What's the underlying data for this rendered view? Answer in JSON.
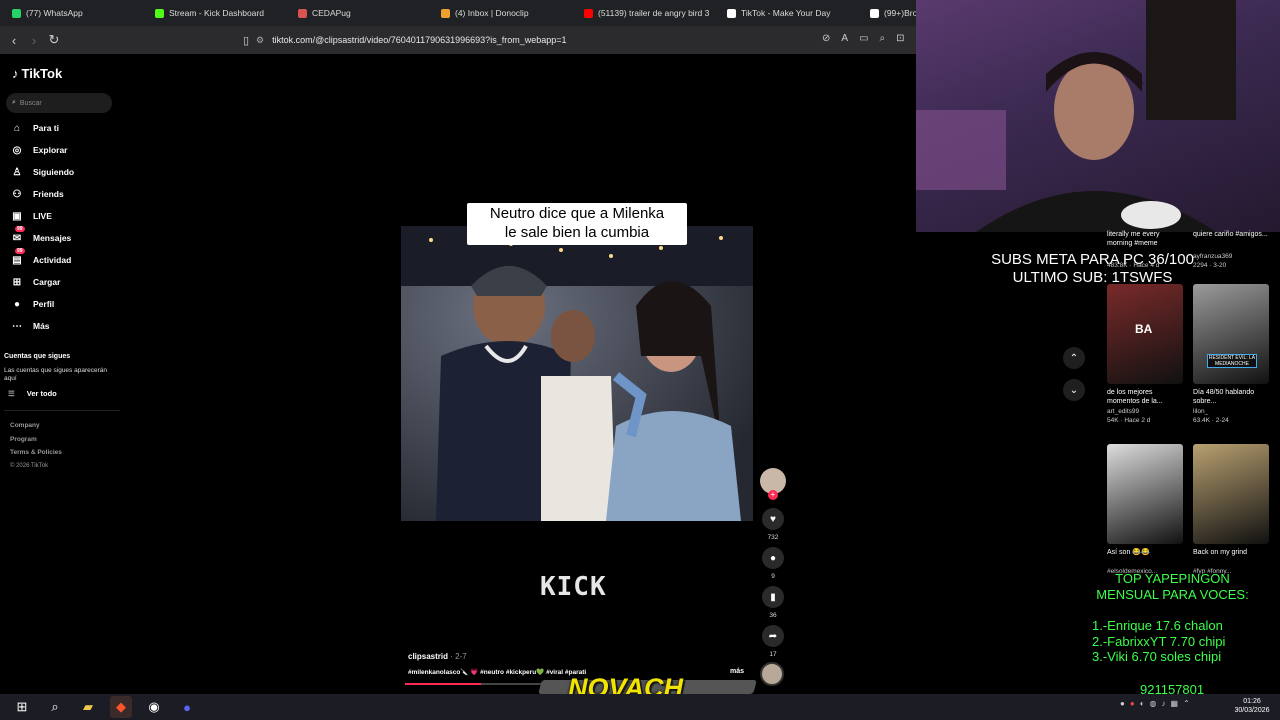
{
  "browser": {
    "tabs": [
      {
        "title": "(77) WhatsApp",
        "color": "#25d366"
      },
      {
        "title": "Stream - Kick Dashboard",
        "color": "#53fc18"
      },
      {
        "title": "CEDAPug",
        "color": "#d9534f"
      },
      {
        "title": "(4) Inbox | Donoclip",
        "color": "#f0a030"
      },
      {
        "title": "(51139) trailer de angry bird 3",
        "color": "#ff0000"
      },
      {
        "title": "TikTok - Make Your Day",
        "color": "#ffffff"
      },
      {
        "title": "(99+)Bro...",
        "color": "#ffffff"
      }
    ],
    "url": "tiktok.com/@clipsastrid/video/7604011790631996693?is_from_webapp=1"
  },
  "tiktok": {
    "logo": "TikTok",
    "search_placeholder": "Buscar",
    "nav": [
      {
        "label": "Para ti",
        "icon": "home-icon",
        "glyph": "⌂"
      },
      {
        "label": "Explorar",
        "icon": "compass-icon",
        "glyph": "◎"
      },
      {
        "label": "Siguiendo",
        "icon": "following-icon",
        "glyph": "♙"
      },
      {
        "label": "Friends",
        "icon": "friends-icon",
        "glyph": "⚇"
      },
      {
        "label": "LIVE",
        "icon": "live-icon",
        "glyph": "▣"
      },
      {
        "label": "Mensajes",
        "icon": "messages-icon",
        "glyph": "✉",
        "badge": "99"
      },
      {
        "label": "Actividad",
        "icon": "activity-icon",
        "glyph": "▤",
        "badge": "99"
      },
      {
        "label": "Cargar",
        "icon": "upload-icon",
        "glyph": "⊞"
      },
      {
        "label": "Perfil",
        "icon": "profile-icon",
        "glyph": "●"
      },
      {
        "label": "Más",
        "icon": "more-icon",
        "glyph": "⋯"
      }
    ],
    "following_title": "Cuentas que sigues",
    "following_desc": "Las cuentas que sigues aparecerán aquí",
    "see_all": "Ver todo",
    "footer": [
      "Company",
      "Program",
      "Terms & Policies",
      "© 2026 TikTok"
    ],
    "video": {
      "caption_line1": "Neutro dice que a Milenka",
      "caption_line2": "le sale bien la cumbia",
      "watermark": "KICK",
      "author": "clipsastrid",
      "date": "· 2-7",
      "hashtags": "#milenkanolasco🔪 💗 #neutro #kickperu💚 #viral #parati",
      "more": "más"
    },
    "actions": {
      "likes": "732",
      "comments": "9",
      "saves": "36",
      "shares": "17"
    }
  },
  "overlay": {
    "subs_line1": "SUBS META PARA PC 36/100",
    "subs_line2": "ULTIMO SUB: 1TSWFS",
    "top_title1": "TOP YAPEPINGON",
    "top_title2": "MENSUAL PARA VOCES:",
    "top_list": [
      "1.-Enrique 17.6 chalon",
      "2.-FabrixxYT 7.70 chipi",
      "3.-Viki 6.70 soles chipi"
    ],
    "phone": "921157801",
    "brand": "NOVACH"
  },
  "feed": [
    {
      "title": "literally me every morning #meme",
      "user": "",
      "stats": "483.8K · Hace 4 d"
    },
    {
      "title": "quiere cariño #amigos...",
      "user": "ayfranzua369",
      "stats": "2294 · 3-20"
    },
    {
      "title": "de los mejores momentos de la...",
      "user": "art_edits99",
      "stats": "54K · Hace 2 d"
    },
    {
      "title": "Día 48/50 hablando sobre...",
      "user": "lilon_",
      "stats": "63.4K · 2-24"
    },
    {
      "title": "Así son 😂😂",
      "user": "#elsoldemexico...",
      "stats": ""
    },
    {
      "title": "Back on my grind",
      "user": "#fyp #fonny...",
      "stats": ""
    }
  ],
  "thumb_labels": {
    "ba": "BA",
    "resident": "RESIDENT EVIL: LA MEDIANOCHE"
  },
  "system": {
    "time": "01:26",
    "date": "30/03/2026"
  }
}
